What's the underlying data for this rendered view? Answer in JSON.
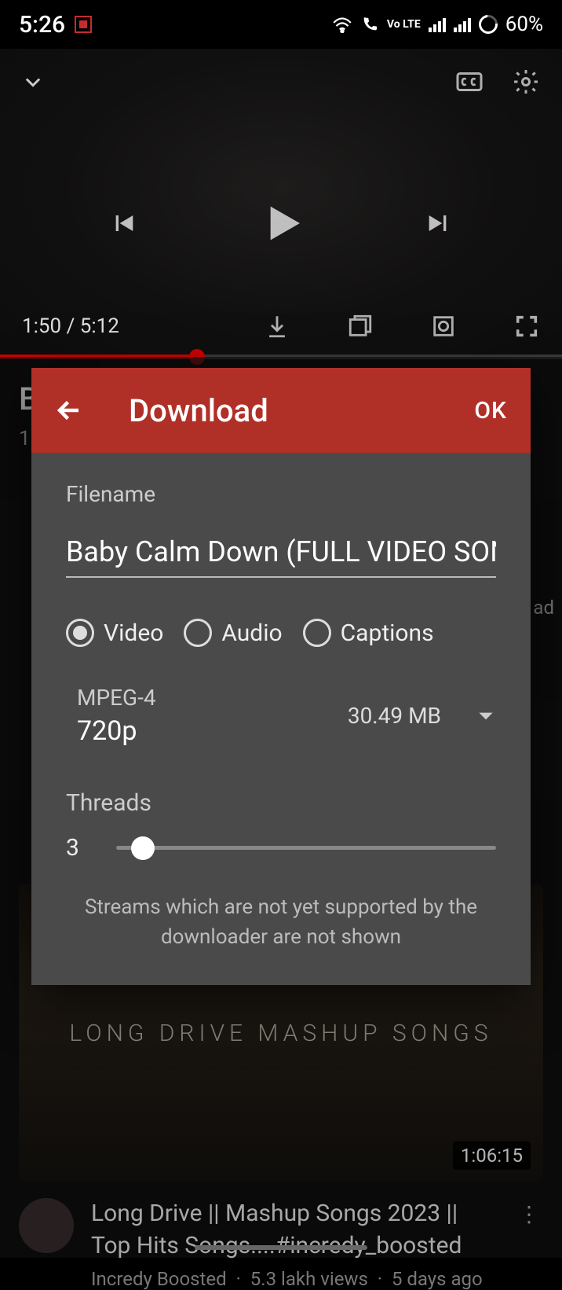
{
  "status": {
    "time": "5:26",
    "battery": "60%",
    "volte": "Vo LTE"
  },
  "player": {
    "current_time": "1:50",
    "duration": "5:12",
    "time_display": "1:50 / 5:12"
  },
  "background": {
    "title_peek": "B",
    "views_peek": "1",
    "ad_label": "ad"
  },
  "dialog": {
    "title": "Download",
    "ok": "OK",
    "filename_label": "Filename",
    "filename_value": "Baby Calm Down (FULL VIDEO SONG)",
    "type_options": {
      "video": "Video",
      "audio": "Audio",
      "captions": "Captions"
    },
    "selected_type": "video",
    "format": {
      "codec": "MPEG-4",
      "resolution": "720p",
      "size": "30.49 MB"
    },
    "threads": {
      "label": "Threads",
      "value": "3"
    },
    "note": "Streams which are not yet supported by the downloader are not shown"
  },
  "related": {
    "thumb_text": "LONG DRIVE MASHUP SONGS",
    "duration": "1:06:15",
    "title": "Long Drive || Mashup Songs 2023 || Top Hits Songs....#incredy_boosted",
    "channel": "Incredy Boosted",
    "views": "5.3 lakh views",
    "age": "5 days ago"
  }
}
